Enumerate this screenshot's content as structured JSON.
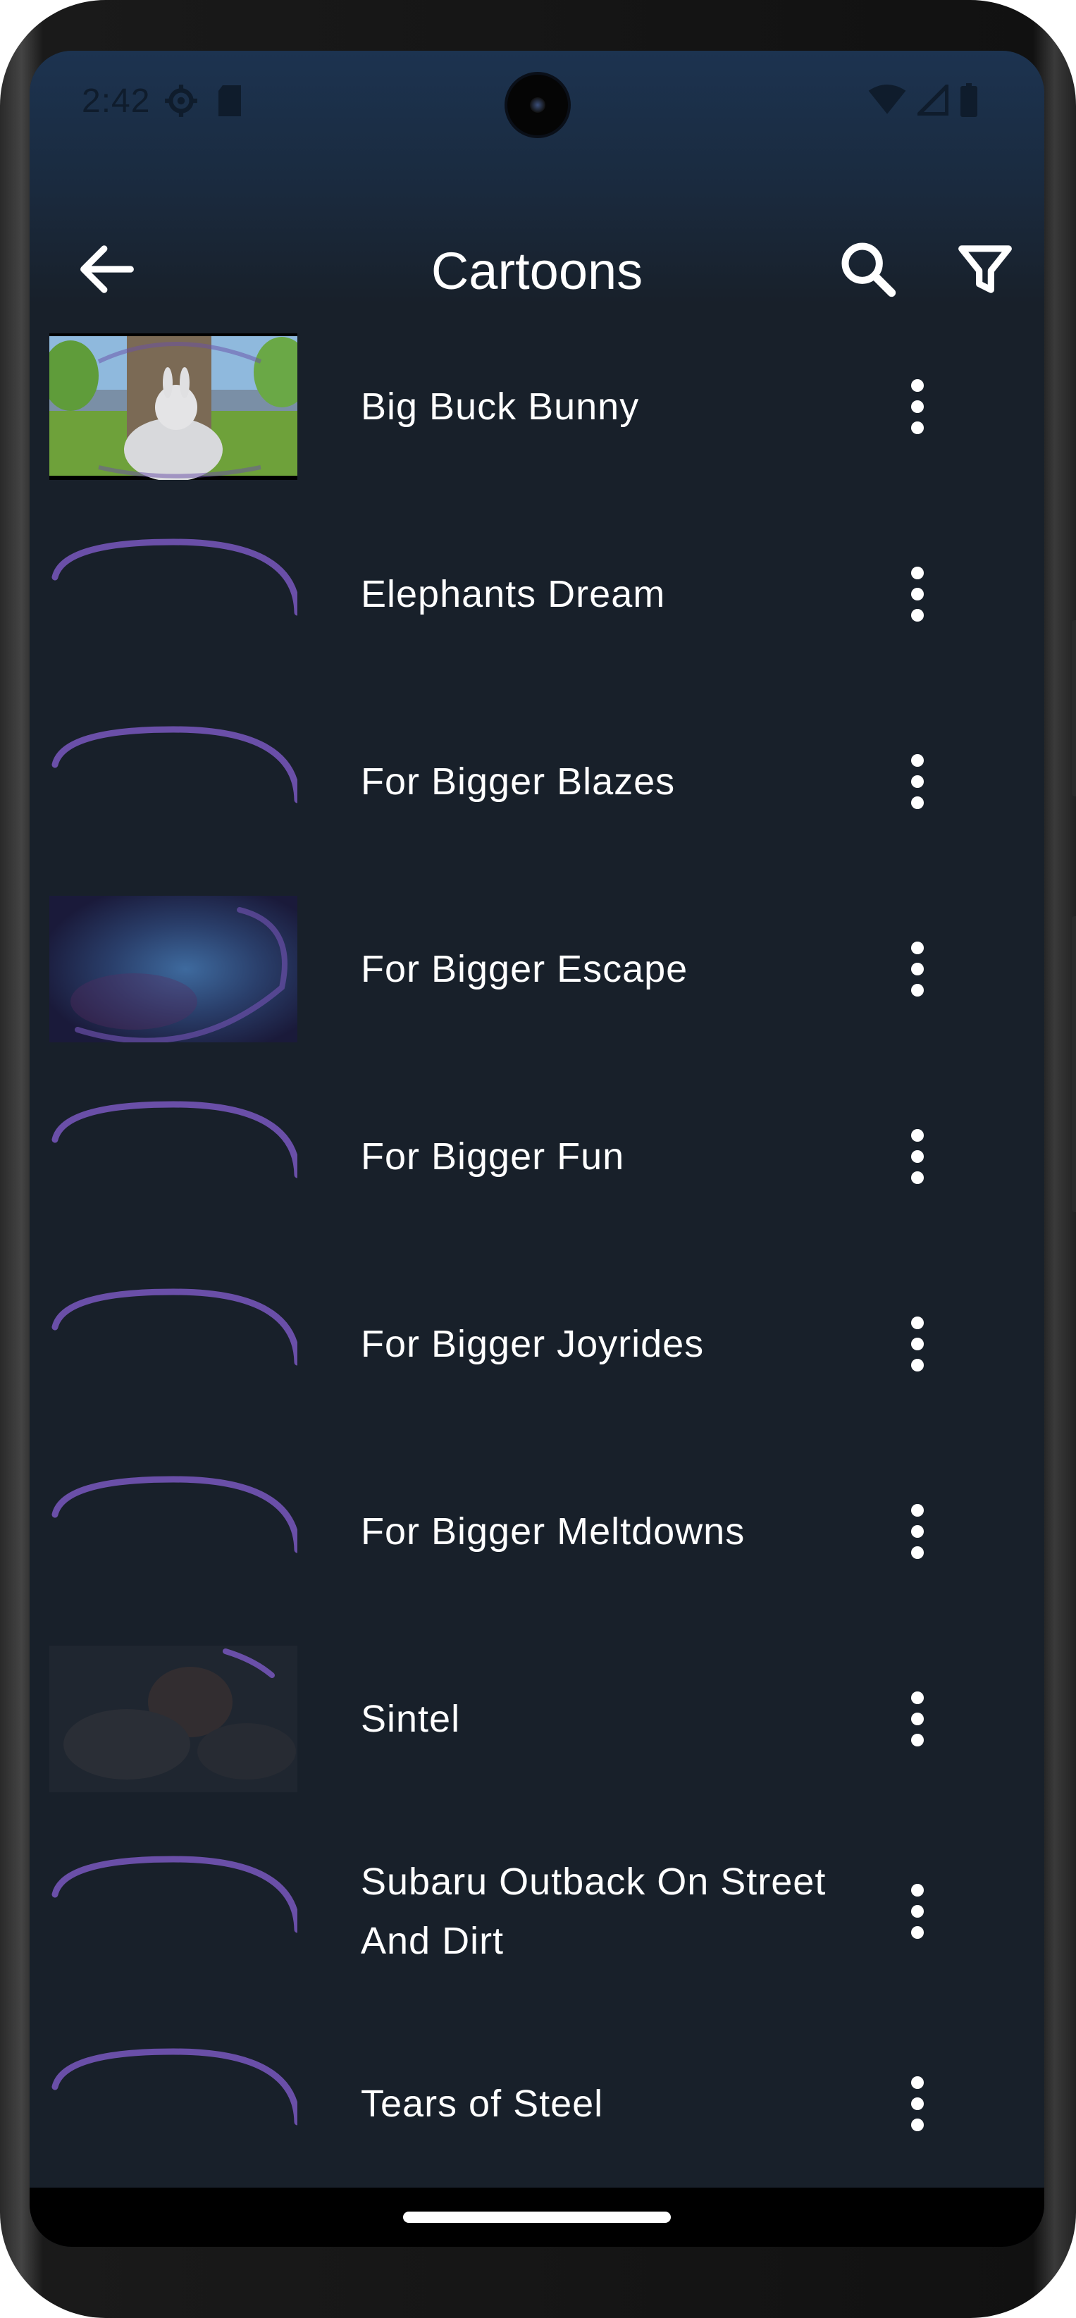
{
  "status_bar": {
    "time": "2:42",
    "left_icons": [
      "settings-gear-icon",
      "sd-card-icon"
    ],
    "right_icons": [
      "wifi-icon",
      "signal-icon",
      "battery-icon"
    ]
  },
  "app_bar": {
    "title": "Cartoons",
    "back_icon": "arrow-back-icon",
    "actions": [
      "search-icon",
      "filter-icon"
    ]
  },
  "videos": [
    {
      "title": "Big Buck Bunny",
      "thumbnail": "bunny"
    },
    {
      "title": "Elephants Dream",
      "thumbnail": "loading"
    },
    {
      "title": "For Bigger Blazes",
      "thumbnail": "loading"
    },
    {
      "title": "For Bigger Escape",
      "thumbnail": "space"
    },
    {
      "title": "For Bigger Fun",
      "thumbnail": "loading"
    },
    {
      "title": "For Bigger Joyrides",
      "thumbnail": "loading"
    },
    {
      "title": "For Bigger Meltdowns",
      "thumbnail": "loading"
    },
    {
      "title": "Sintel",
      "thumbnail": "dark-scene"
    },
    {
      "title": "Subaru Outback On Street And Dirt",
      "thumbnail": "loading"
    },
    {
      "title": "Tears of Steel",
      "thumbnail": "loading"
    }
  ],
  "colors": {
    "background": "#18202a",
    "accent_spinner": "#6a4fa8",
    "text": "#ffffff"
  }
}
